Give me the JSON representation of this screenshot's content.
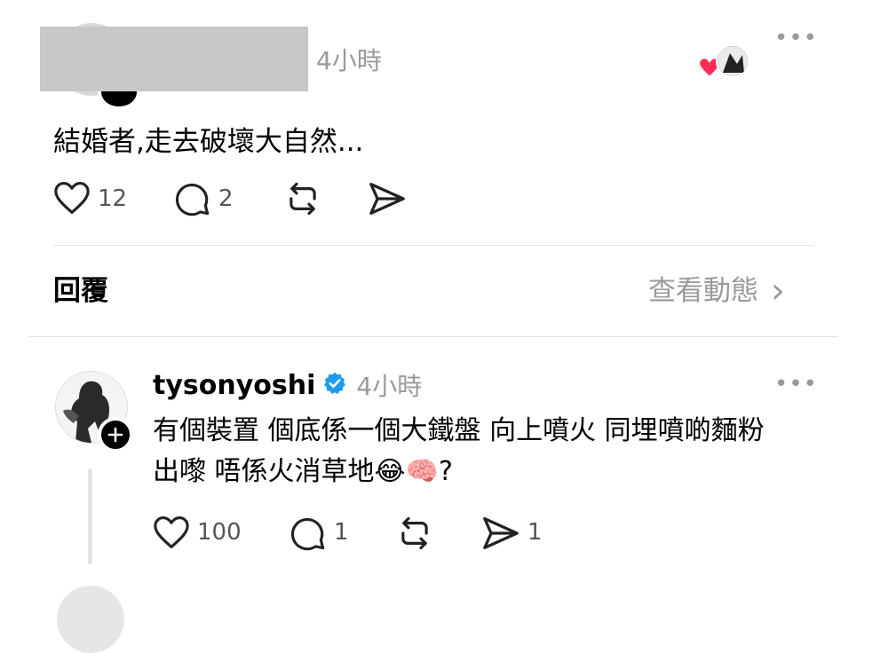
{
  "colors": {
    "redaction": "#c7c7c7",
    "muted_text": "#9a9a9a",
    "divider": "#e3e3e3",
    "verified_blue": "#1d9bf0",
    "heart_red": "#ff2d55"
  },
  "original_post": {
    "time": "4小時",
    "text": "結婚者,走去破壞大自然...",
    "likes": "12",
    "replies": "2",
    "more": "•••"
  },
  "replies_header": {
    "title": "回覆",
    "view_activity": "查看動態",
    "chevron": "›"
  },
  "reply": {
    "username": "tysonyoshi",
    "time": "4小時",
    "more": "•••",
    "line1": "有個裝置 個底係一個大鐵盤 向上噴火 同埋噴啲麵粉",
    "line2_text": "出嚟 唔係火消草地",
    "emoji1": "😂",
    "emoji2": "🧠",
    "line2_end": "?",
    "likes": "100",
    "replies": "1",
    "shares": "1"
  },
  "icons": {
    "like": "heart-outline-icon",
    "comment": "speech-bubble-icon",
    "repost": "repost-icon",
    "share": "send-icon",
    "verified": "verified-badge-icon",
    "follow": "plus-follow-icon"
  }
}
